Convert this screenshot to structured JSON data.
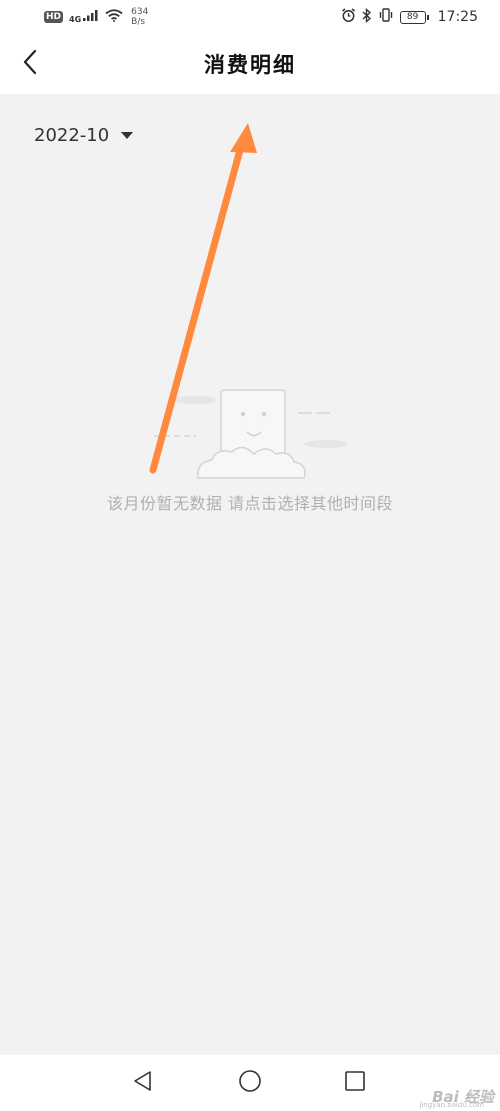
{
  "status_bar": {
    "hd_badge": "HD",
    "network_type": "4G",
    "speed_value": "634",
    "speed_unit": "B/s",
    "battery_level": "89",
    "time": "17:25",
    "icons": [
      "signal-icon",
      "wifi-icon",
      "alarm-icon",
      "bluetooth-icon",
      "vibrate-icon",
      "battery-icon"
    ]
  },
  "navbar": {
    "title": "消费明细",
    "back_icon": "chevron-left-icon"
  },
  "month_selector": {
    "value": "2022-10",
    "dropdown_icon": "caret-down-icon"
  },
  "empty_state": {
    "message": "该月份暂无数据 请点击选择其他时间段",
    "illustration": "empty-box-icon"
  },
  "annotation": {
    "color": "#ff8a3d"
  },
  "bottom_nav": {
    "back_icon": "triangle-back-icon",
    "home_icon": "circle-home-icon",
    "recent_icon": "square-recent-icon"
  },
  "watermark": {
    "text": "Bai 经验",
    "sub": "jingyan.baidu.com"
  }
}
